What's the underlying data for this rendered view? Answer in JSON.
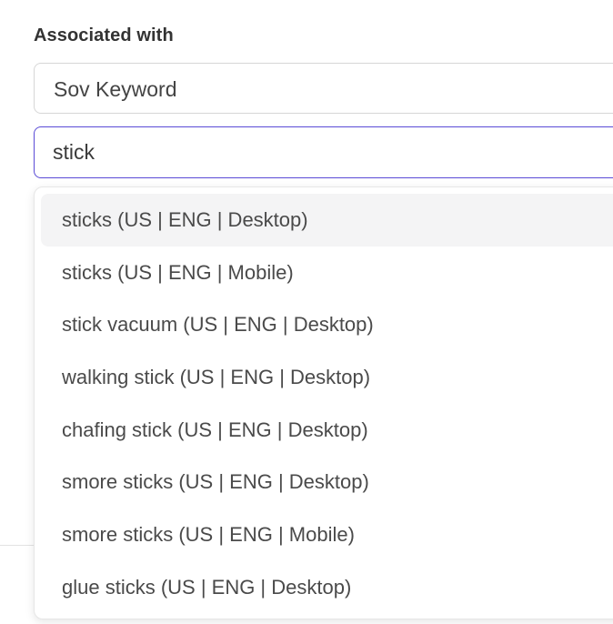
{
  "form": {
    "label": "Associated with",
    "select_value": "Sov Keyword",
    "search_value": "stick"
  },
  "dropdown": {
    "options": [
      "sticks (US | ENG | Desktop)",
      "sticks (US | ENG | Mobile)",
      "stick vacuum (US | ENG | Desktop)",
      "walking stick (US | ENG | Desktop)",
      "chafing stick (US | ENG | Desktop)",
      "smore sticks (US | ENG | Desktop)",
      "smore sticks (US | ENG | Mobile)",
      "glue sticks (US | ENG | Desktop)"
    ]
  },
  "colors": {
    "focus_border": "#5a4bd6",
    "highlight_bg": "#f4f4f5"
  }
}
